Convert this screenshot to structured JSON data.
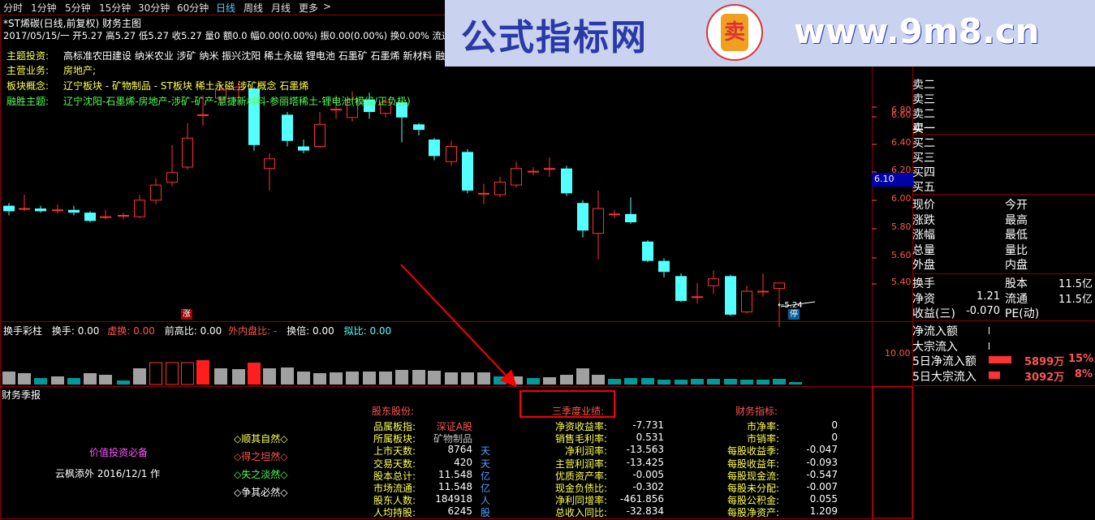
{
  "period_tabs": [
    {
      "label": "分时",
      "active": false
    },
    {
      "label": "1分钟",
      "active": false
    },
    {
      "label": "5分钟",
      "active": false
    },
    {
      "label": "15分钟",
      "active": false
    },
    {
      "label": "30分钟",
      "active": false
    },
    {
      "label": "60分钟",
      "active": false
    },
    {
      "label": "日线",
      "active": true
    },
    {
      "label": "周线",
      "active": false
    },
    {
      "label": "月线",
      "active": false
    },
    {
      "label": "更多",
      "active": false
    }
  ],
  "more_arrow": ">",
  "watermark": {
    "text": "公式指标网",
    "url": "www.9m8.cn",
    "logo_char": "卖"
  },
  "chart_title": "*ST烯碳(日线,前复权) 财务主图",
  "ohlc_line": "2017/05/15/一 开5.27 高5.27 低5.27 收5.27 量0 额0.0 幅0.00(0.00%) 振0.00(0.00%) 换0.00% 流通11.",
  "info": [
    {
      "label": "主题投资:",
      "value": "高标准农田建设 纳米农业 涉矿 纳米 振兴沈阳 稀土永磁 锂电池 石墨矿 石墨烯 新材料 融摸"
    },
    {
      "label": "主营业务:",
      "value": "房地产;"
    },
    {
      "label": "板块概念:",
      "value": "辽宁板块 - 矿物制品 - ST板块 稀土永磁 涉矿概念 石墨烯"
    },
    {
      "label": "融胜主题:",
      "value": "辽宁沈阳-石墨烯-房地产-涉矿-矿产-慧捷新材料-参丽塔稀土-锂电池(模组/正负极)"
    }
  ],
  "price_axis": [
    "6.80",
    "6.60",
    "6.40",
    "6.20",
    "6.00",
    "5.80",
    "5.60",
    "5.40"
  ],
  "current_price_tag": "6.10",
  "low_marker": "5.24",
  "zhang_tag": "涨",
  "ting_tag": "停",
  "volume_header": {
    "title": "换手彩柱",
    "items": [
      {
        "label": "换手:",
        "value": "0.00",
        "color": "#ffffff"
      },
      {
        "label": "虚换:",
        "value": "0.00",
        "color": "#ff5454"
      },
      {
        "label": "前高比:",
        "value": "0.00",
        "color": "#ffffff"
      },
      {
        "label": "外内盘比:",
        "value": "-",
        "color": "#ff5454"
      },
      {
        "label": "换倍:",
        "value": "0.00",
        "color": "#ffffff"
      },
      {
        "label": "拟比:",
        "value": "0.00",
        "color": "#54ffff"
      }
    ]
  },
  "volume_axis": "10.00",
  "fin_title": "财务季报",
  "value_invest": {
    "title": "价值投资必备",
    "author": "云枫添外 2016/12/1 作"
  },
  "mottos": [
    {
      "text": "◇顺其自然◇",
      "color": "#ffff54"
    },
    {
      "text": "◇得之坦然◇",
      "color": "#ff5454"
    },
    {
      "text": "◇失之淡然◇",
      "color": "#54ff54"
    },
    {
      "text": "◇争其必然◇",
      "color": "#ffffff"
    }
  ],
  "shareholder": {
    "title": "股东股份:",
    "rows": [
      {
        "label": "品属板指:",
        "value": "深证A股",
        "unit": ""
      },
      {
        "label": "所属板块:",
        "value": "矿物制品",
        "unit": ""
      },
      {
        "label": "上市天数:",
        "value": "8764",
        "unit": "天"
      },
      {
        "label": "交易天数:",
        "value": "420",
        "unit": "天"
      },
      {
        "label": "股本总计:",
        "value": "11.548",
        "unit": "亿"
      },
      {
        "label": "市场流通:",
        "value": "11.548",
        "unit": "亿"
      },
      {
        "label": "股东人数:",
        "value": "184918",
        "unit": "人"
      },
      {
        "label": "人均持股:",
        "value": "6245",
        "unit": "股"
      }
    ]
  },
  "q3": {
    "title": "三季度业绩:",
    "rows": [
      {
        "label": "净资收益率:",
        "value": "-7.731"
      },
      {
        "label": "销售毛利率:",
        "value": "0.531"
      },
      {
        "label": "净利润率:",
        "value": "-13.563"
      },
      {
        "label": "主营利润率:",
        "value": "-13.425"
      },
      {
        "label": "优质资产率:",
        "value": "-0.005"
      },
      {
        "label": "现金负债比:",
        "value": "-0.302"
      },
      {
        "label": "净利同增率:",
        "value": "-461.856"
      },
      {
        "label": "总收入同比:",
        "value": "-32.834"
      }
    ]
  },
  "fin_idx": {
    "title": "财务指标:",
    "rows": [
      {
        "label": "市净率:",
        "value": "0"
      },
      {
        "label": "市销率:",
        "value": "0"
      },
      {
        "label": "每股收益季:",
        "value": "-0.047"
      },
      {
        "label": "每股收益年:",
        "value": "-0.093"
      },
      {
        "label": "每股现金流:",
        "value": "-0.547"
      },
      {
        "label": "每股未分配:",
        "value": "-0.007"
      },
      {
        "label": "每股公积金:",
        "value": "0.055"
      },
      {
        "label": "每股净资产:",
        "value": "1.209"
      }
    ]
  },
  "orderbook": {
    "sell": [
      "卖二",
      "卖三",
      "卖二",
      "卖一"
    ],
    "buy": [
      "买一",
      "买二",
      "买三",
      "买四",
      "买五"
    ]
  },
  "quote_rows": [
    {
      "l": "现价",
      "r": "今开"
    },
    {
      "l": "涨跌",
      "r": "最高"
    },
    {
      "l": "涨幅",
      "r": "最低"
    },
    {
      "l": "总量",
      "r": "量比"
    },
    {
      "l": "外盘",
      "r": "内盘"
    }
  ],
  "stock_rows": [
    {
      "l": "换手",
      "r": "股本",
      "rv": "11.5亿",
      "lv": ""
    },
    {
      "l": "净资",
      "lv": "1.21",
      "r": "流通",
      "rv": "11.5亿"
    },
    {
      "l": "收益(三)",
      "lv": "-0.070",
      "r": "PE(动)",
      "rv": ""
    }
  ],
  "flow_rows": [
    {
      "label": "净流入额",
      "value": "",
      "pct": ""
    },
    {
      "label": "大宗流入",
      "value": "",
      "pct": ""
    },
    {
      "label": "5日净流入额",
      "value": "5899万",
      "pct": "15%"
    },
    {
      "label": "5日大宗流入",
      "value": "3092万",
      "pct": "8%"
    }
  ],
  "colors": {
    "up": "#ff3232",
    "down": "#54ffff",
    "grid": "#8b0000",
    "vol_gray": "#a0a0a0",
    "vol_teal": "#009a9a",
    "accent": "#ff0000"
  }
}
